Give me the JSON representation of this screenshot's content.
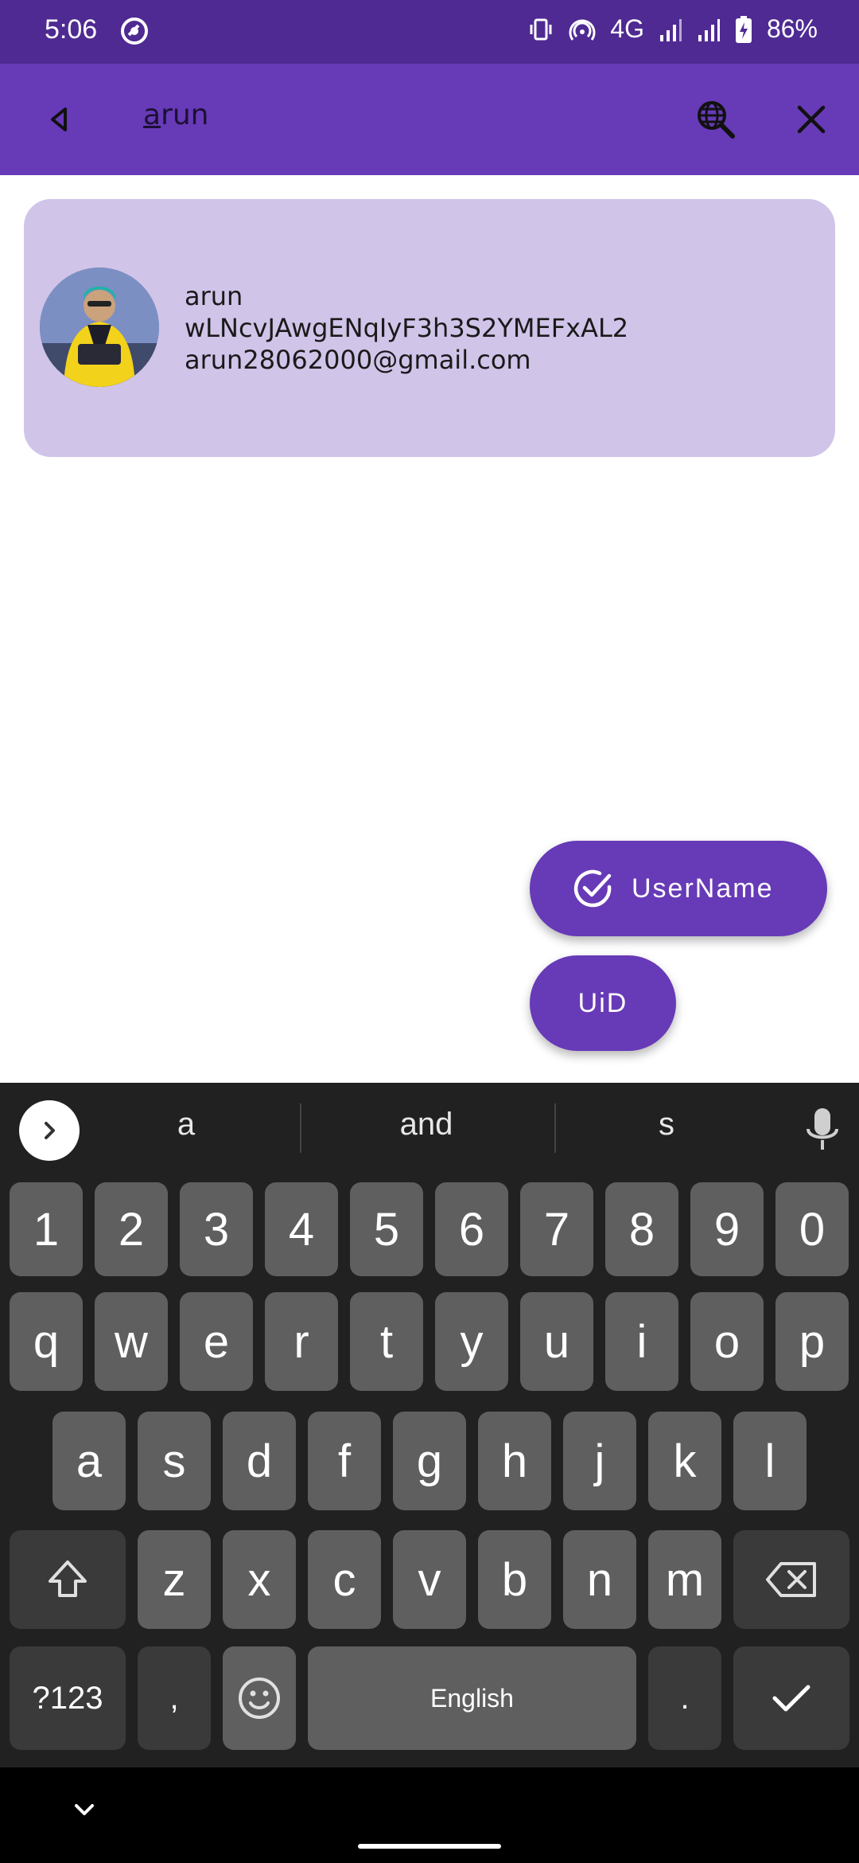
{
  "status_bar": {
    "time": "5:06",
    "network": "4G",
    "battery": "86%",
    "icons": [
      "dnd-icon",
      "vibrate-icon",
      "hotspot-icon",
      "signal-icon",
      "signal-icon",
      "battery-charging-icon"
    ]
  },
  "search_bar": {
    "query_underlined": "a",
    "query_rest": "run",
    "query": "arun",
    "icons": {
      "back": "back-triangle-icon",
      "globe_search": "globe-search-icon",
      "close": "close-icon"
    }
  },
  "result": {
    "name": "arun",
    "uid": "wLNcvJAwgENqIyF3h3S2YMEFxAL2",
    "email": "arun28062000@gmail.com"
  },
  "fabs": {
    "username_label": "UserName",
    "uid_label": "UiD"
  },
  "keyboard": {
    "suggestions": [
      "a",
      "and",
      "s"
    ],
    "number_row": [
      "1",
      "2",
      "3",
      "4",
      "5",
      "6",
      "7",
      "8",
      "9",
      "0"
    ],
    "row1": [
      "q",
      "w",
      "e",
      "r",
      "t",
      "y",
      "u",
      "i",
      "o",
      "p"
    ],
    "row2": [
      "a",
      "s",
      "d",
      "f",
      "g",
      "h",
      "j",
      "k",
      "l"
    ],
    "row3": [
      "z",
      "x",
      "c",
      "v",
      "b",
      "n",
      "m"
    ],
    "symbols_label": "?123",
    "comma": ",",
    "space_label": "English",
    "period": "."
  },
  "colors": {
    "status_bar": "#4f2a92",
    "app_bar": "#673ab7",
    "card": "#d1c4e9",
    "fab": "#673ab7",
    "keyboard_bg": "#212121",
    "key": "#5f5f5f",
    "key_dark": "#3a3a3a"
  }
}
